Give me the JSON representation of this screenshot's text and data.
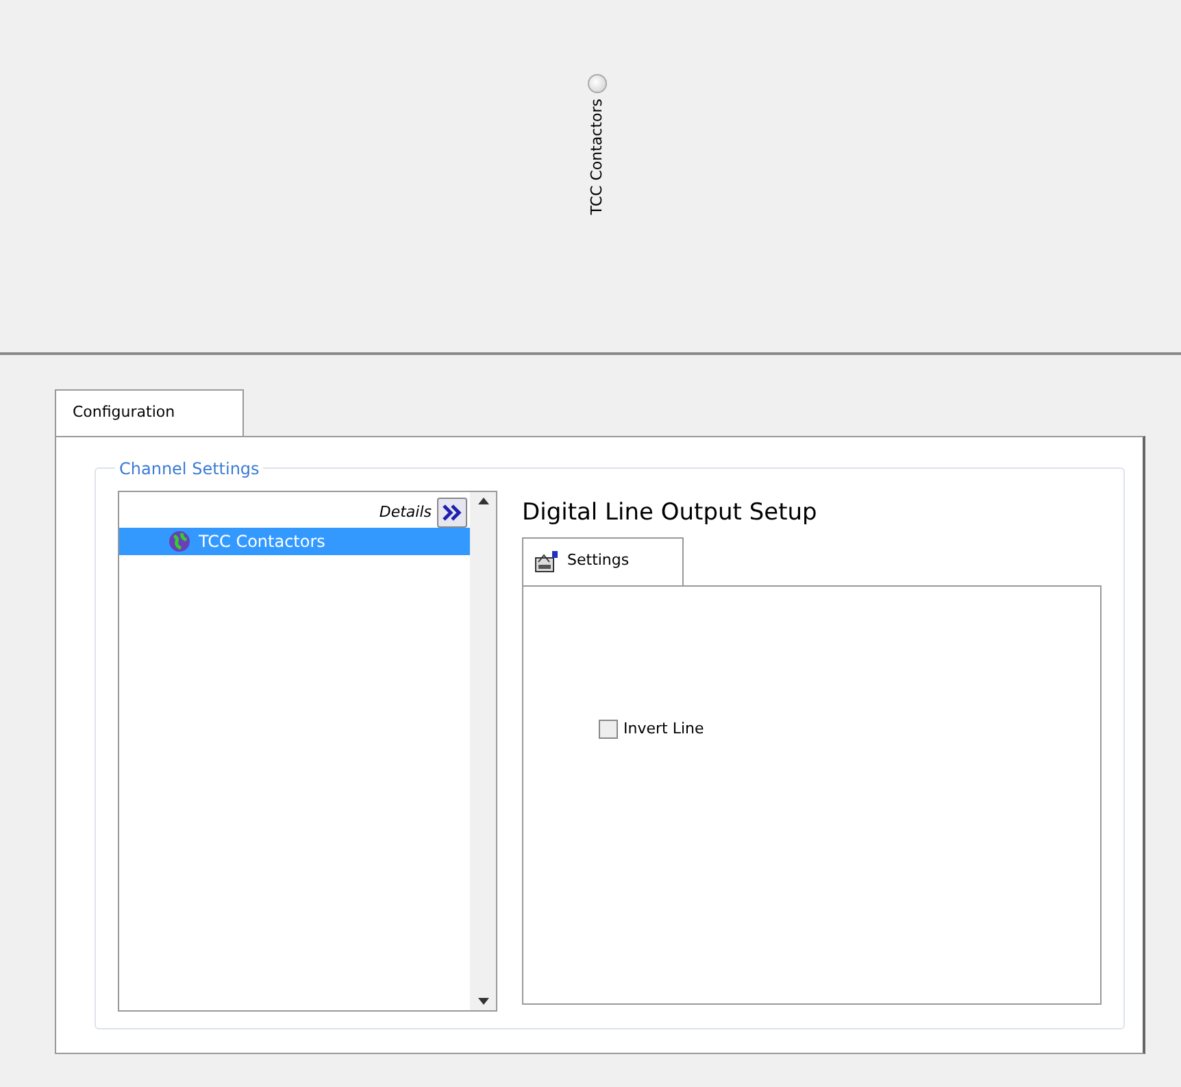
{
  "indicator": {
    "label": "TCC Contactors",
    "on": false
  },
  "tabs": [
    {
      "label": "Configuration",
      "selected": true
    }
  ],
  "channel_settings": {
    "label": "Channel Settings",
    "details_label": "Details",
    "channels": [
      {
        "label": "TCC Contactors",
        "selected": true
      }
    ]
  },
  "setup": {
    "title": "Digital Line Output Setup",
    "tabs": [
      {
        "label": "Settings",
        "selected": true
      }
    ],
    "invert_line": {
      "label": "Invert Line",
      "checked": false
    }
  }
}
